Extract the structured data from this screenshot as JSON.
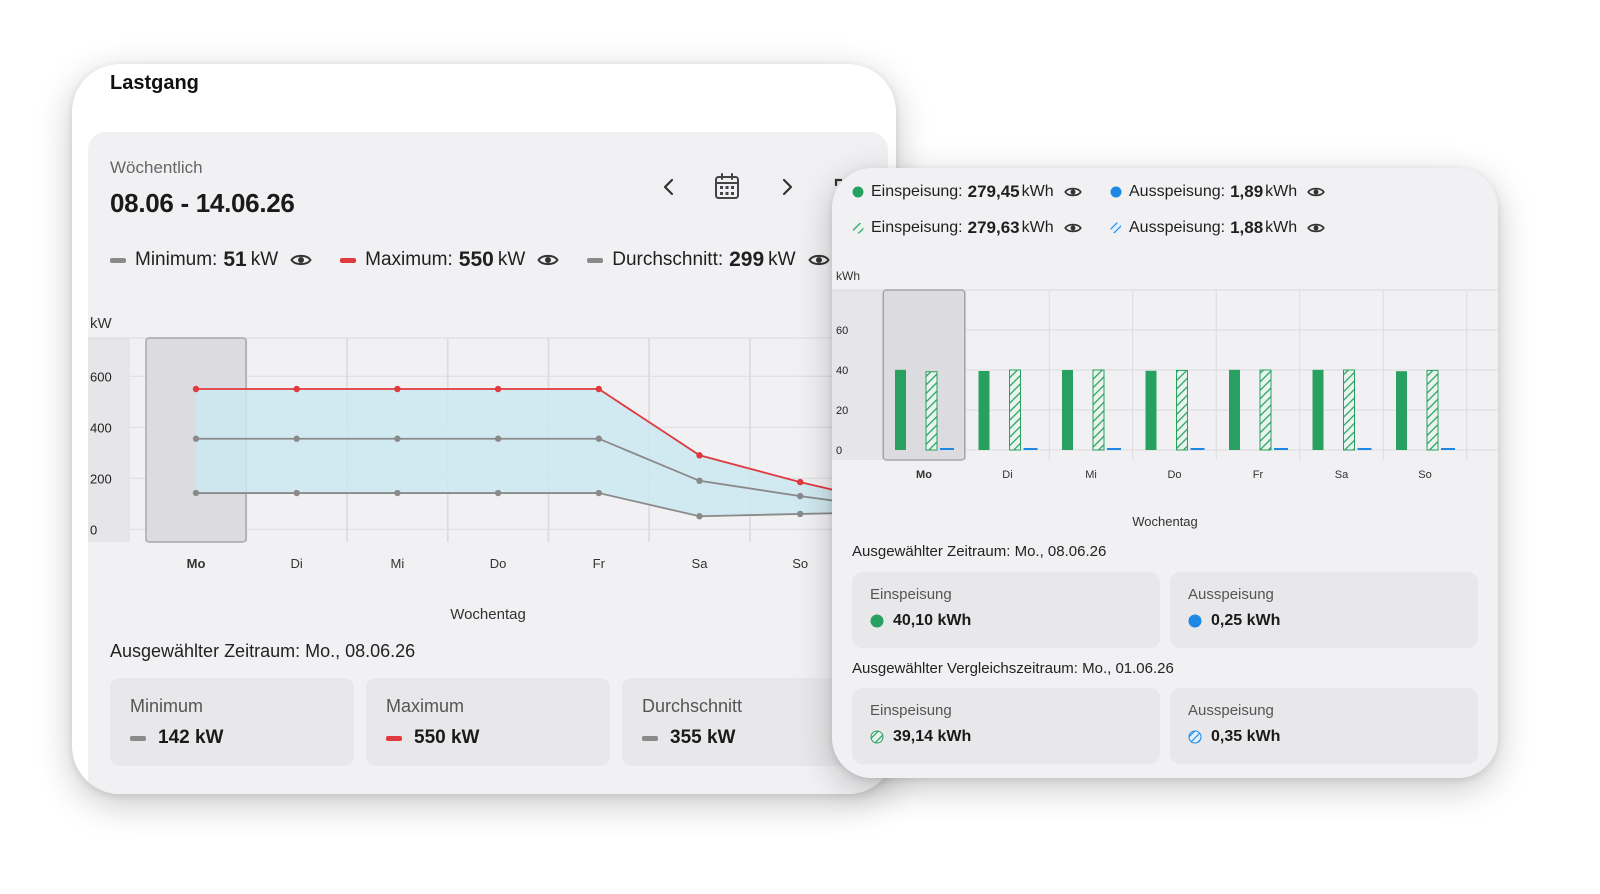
{
  "load_profile": {
    "title": "Lastgang",
    "period_label": "Wöchentlich",
    "period_range": "08.06 - 14.06.26",
    "legend": [
      {
        "label": "Minimum:",
        "value": "51",
        "unit": "kW",
        "color": "#8a8a8a"
      },
      {
        "label": "Maximum:",
        "value": "550",
        "unit": "kW",
        "color": "#e0393e"
      },
      {
        "label": "Durchschnitt:",
        "value": "299",
        "unit": "kW",
        "color": "#8a8a8a"
      }
    ],
    "x_axis_title": "Wochentag",
    "selected_period": "Ausgewählter Zeitraum: Mo., 08.06.26",
    "tiles": [
      {
        "label": "Minimum",
        "value": "142 kW",
        "color": "#8a8a8a"
      },
      {
        "label": "Maximum",
        "value": "550 kW",
        "color": "#e0393e"
      },
      {
        "label": "Durchschnitt",
        "value": "355 kW",
        "color": "#8a8a8a"
      }
    ]
  },
  "energy": {
    "legend_row1": [
      {
        "label": "Einspeisung:",
        "value": "279,45",
        "unit": "kWh",
        "color": "#27a060",
        "style": "solid"
      },
      {
        "label": "Ausspeisung:",
        "value": "1,89",
        "unit": "kWh",
        "color": "#1e88e5",
        "style": "solid"
      }
    ],
    "legend_row2": [
      {
        "label": "Einspeisung:",
        "value": "279,63",
        "unit": "kWh",
        "color": "#27a060",
        "style": "hatched"
      },
      {
        "label": "Ausspeisung:",
        "value": "1,88",
        "unit": "kWh",
        "color": "#1e88e5",
        "style": "hatched"
      }
    ],
    "x_axis_title": "Wochentag",
    "selected_period": "Ausgewählter Zeitraum: Mo., 08.06.26",
    "tiles_selected": [
      {
        "label": "Einspeisung",
        "value": "40,10 kWh",
        "color": "#27a060",
        "style": "solid"
      },
      {
        "label": "Ausspeisung",
        "value": "0,25 kWh",
        "color": "#1e88e5",
        "style": "solid"
      }
    ],
    "compare_period": "Ausgewählter Vergleichszeitraum: Mo., 01.06.26",
    "tiles_compare": [
      {
        "label": "Einspeisung",
        "value": "39,14 kWh",
        "color": "#27a060",
        "style": "hatched"
      },
      {
        "label": "Ausspeisung",
        "value": "0,35 kWh",
        "color": "#1e88e5",
        "style": "hatched"
      }
    ]
  },
  "chart_data": [
    {
      "type": "line",
      "ylabel": "kW",
      "xlabel": "Wochentag",
      "categories": [
        "Mo",
        "Di",
        "Mi",
        "Do",
        "Fr",
        "Sa",
        "So"
      ],
      "yticks": [
        0,
        200,
        400,
        600
      ],
      "ylim": [
        -50,
        750
      ],
      "selected_category": "Mo",
      "series": [
        {
          "name": "Maximum",
          "color": "#e0393e",
          "values": [
            550,
            550,
            550,
            550,
            550,
            290,
            185
          ]
        },
        {
          "name": "Durchschnitt",
          "color": "#8a8a8a",
          "values": [
            355,
            355,
            355,
            355,
            355,
            190,
            130
          ]
        },
        {
          "name": "Minimum",
          "color": "#8a8a8a",
          "values": [
            142,
            142,
            142,
            142,
            142,
            51,
            60
          ]
        }
      ],
      "band_fill": "#cbe7ee"
    },
    {
      "type": "bar",
      "ylabel": "kWh",
      "xlabel": "Wochentag",
      "categories": [
        "Mo",
        "Di",
        "Mi",
        "Do",
        "Fr",
        "Sa",
        "So"
      ],
      "yticks": [
        0,
        20,
        40,
        60
      ],
      "ylim": [
        -5,
        80
      ],
      "selected_category": "Mo",
      "series": [
        {
          "name": "Einspeisung",
          "style": "solid",
          "color": "#27a060",
          "values": [
            40.1,
            39.5,
            40.0,
            39.6,
            40.1,
            40.1,
            39.4
          ]
        },
        {
          "name": "Einspeisung",
          "style": "hatched",
          "color": "#27a060",
          "values": [
            39.14,
            40.0,
            40.0,
            39.8,
            40.0,
            40.0,
            39.8
          ]
        },
        {
          "name": "Ausspeisung",
          "style": "solid",
          "color": "#1e88e5",
          "values": [
            0.25,
            0.3,
            0.3,
            0.25,
            0.3,
            0.25,
            0.24
          ]
        }
      ]
    }
  ]
}
